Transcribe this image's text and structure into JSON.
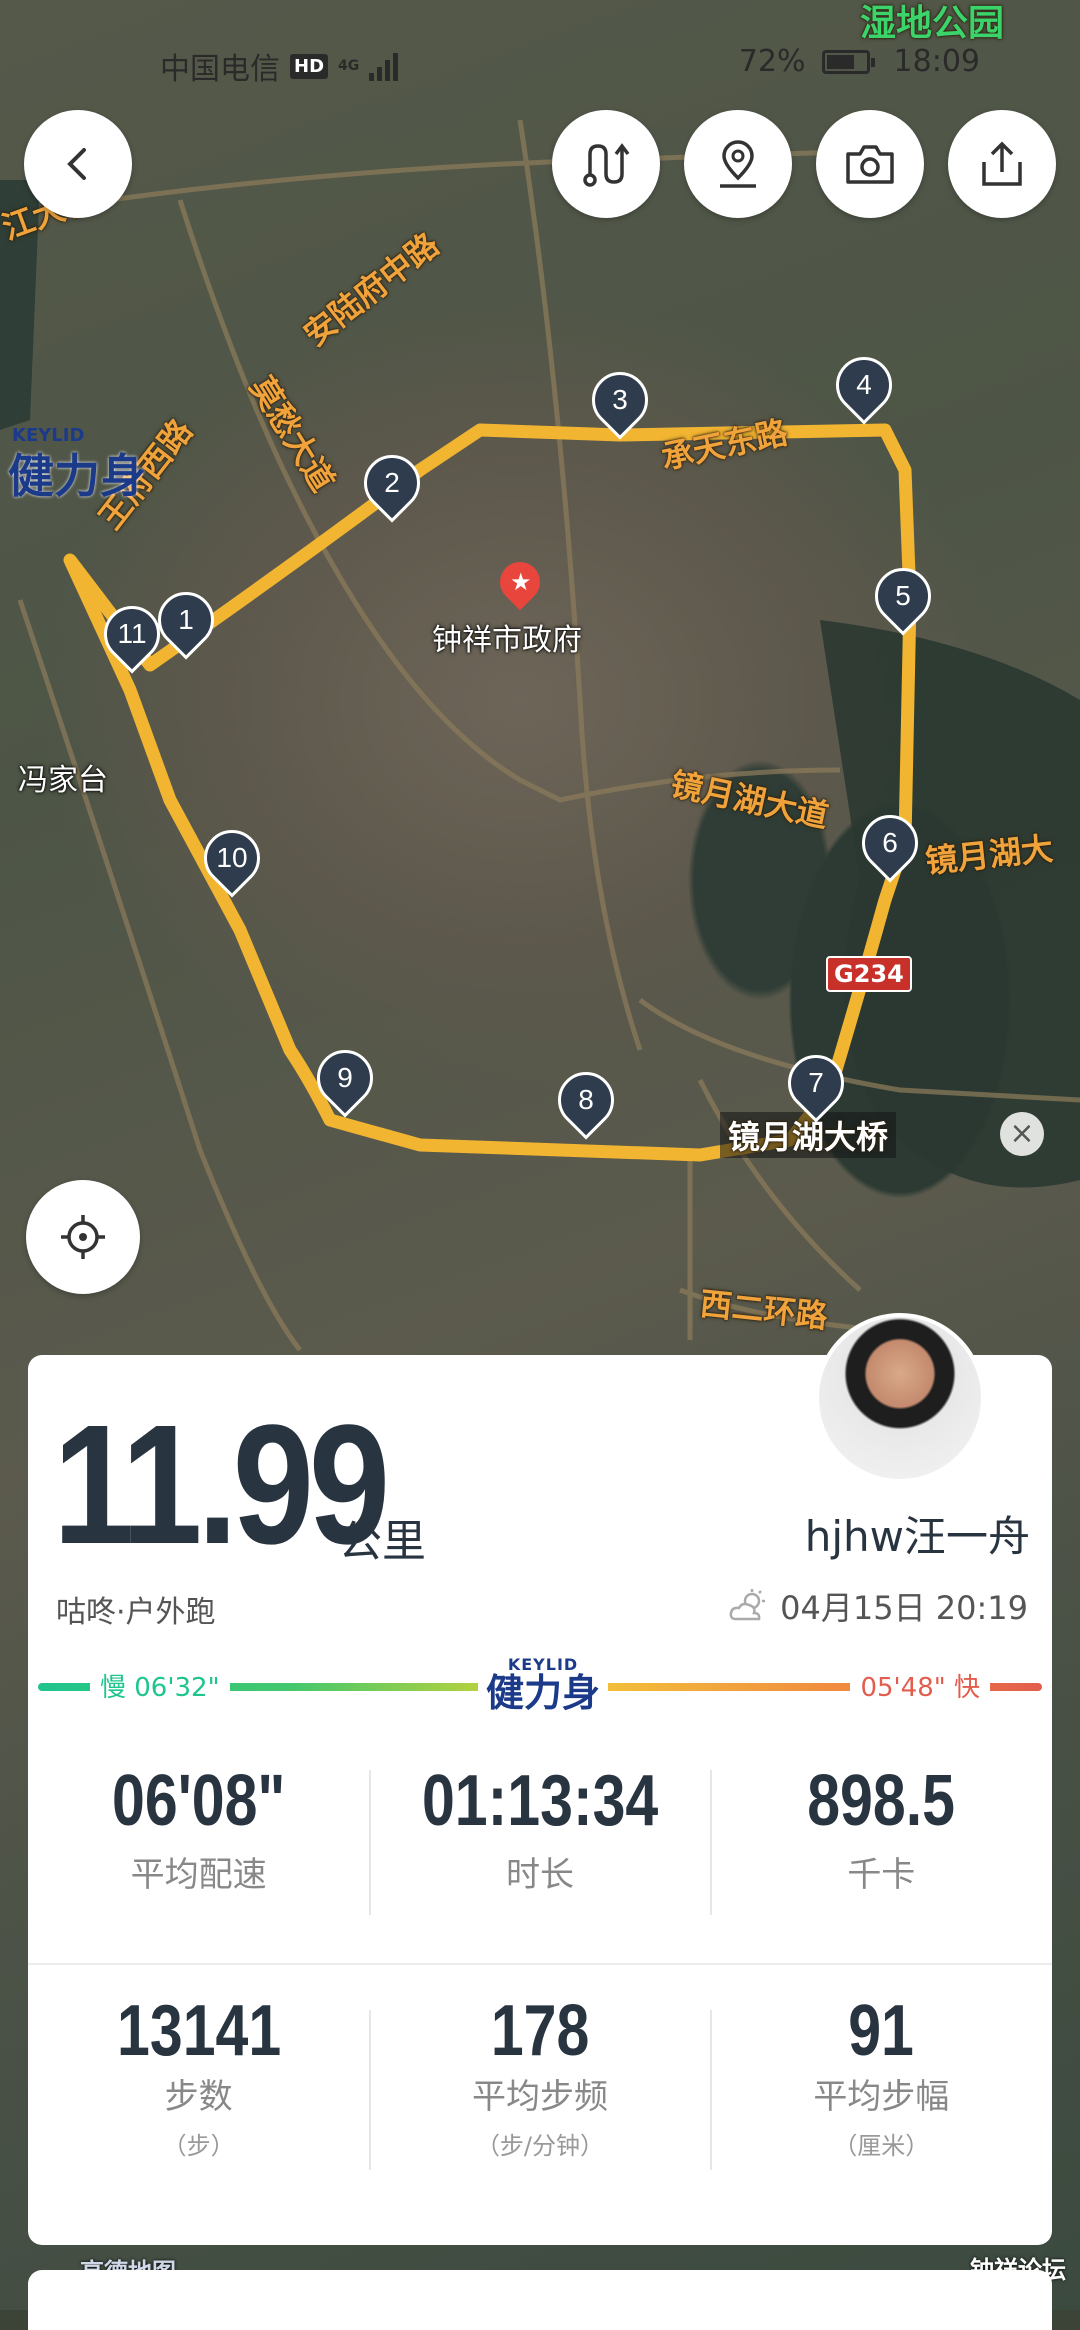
{
  "status_bar": {
    "carrier": "中国电信",
    "hd": "HD",
    "network": "4G",
    "battery": "72%",
    "battery_level": 0.72,
    "time": "18:09"
  },
  "map": {
    "top_label": "湿地公园",
    "road_labels": [
      "安陆府中路",
      "承天东路",
      "莫愁大道",
      "镜月湖大道",
      "镜月湖大",
      "镜月湖大桥",
      "西二环路",
      "王府西路",
      "江大桥",
      "G234"
    ],
    "places": [
      "钟祥市政府",
      "冯家台"
    ],
    "markers": [
      "1",
      "2",
      "3",
      "4",
      "5",
      "6",
      "7",
      "8",
      "9",
      "10",
      "11"
    ],
    "watermark_bottom": "高德地图",
    "watermark_corner": "钟祥论坛"
  },
  "toolbar": {
    "back": "back-icon",
    "route": "route-icon",
    "location_pin": "location-pin-icon",
    "camera": "camera-icon",
    "share": "share-icon",
    "locate": "locate-icon"
  },
  "summary": {
    "distance": "11.99",
    "unit": "公里",
    "user": "hjhw汪一舟",
    "activity": "咕咚·户外跑",
    "datetime": "04月15日 20:19",
    "weather_icon": "partly-cloudy-icon"
  },
  "pace_legend": {
    "slow": "慢 06'32\"",
    "fast": "05'48\" 快",
    "brand_en": "KEYLID",
    "brand_cn": "健力身"
  },
  "stats_row1": [
    {
      "value": "06'08\"",
      "label": "平均配速"
    },
    {
      "value": "01:13:34",
      "label": "时长"
    },
    {
      "value": "898.5",
      "label": "千卡"
    }
  ],
  "stats_row2": [
    {
      "value": "13141",
      "label": "步数",
      "sub": "（步）"
    },
    {
      "value": "178",
      "label": "平均步频",
      "sub": "（步/分钟）"
    },
    {
      "value": "91",
      "label": "平均步幅",
      "sub": "（厘米）"
    }
  ],
  "colors": {
    "route": "#f2b531",
    "marker": "#2f3c4d",
    "dark_text": "#293441",
    "slow_green": "#1fc58e",
    "fast_red": "#e25d4e"
  }
}
